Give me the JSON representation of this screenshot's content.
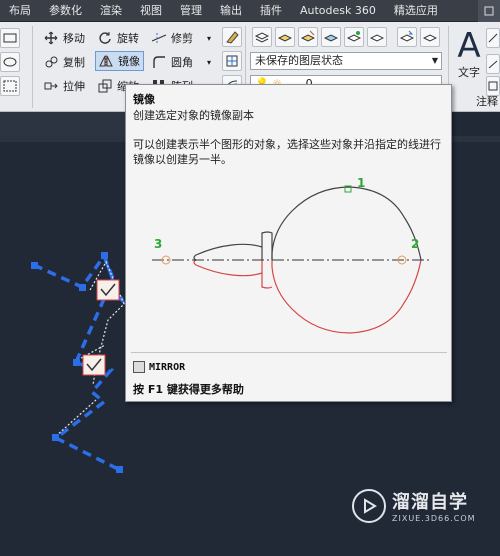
{
  "menubar": {
    "items": [
      "布局",
      "参数化",
      "渲染",
      "视图",
      "管理",
      "输出",
      "插件",
      "Autodesk 360",
      "精选应用"
    ]
  },
  "ribbon": {
    "modify": {
      "move": "移动",
      "rotate": "旋转",
      "trim": "修剪",
      "copy": "复制",
      "mirror": "镜像",
      "fillet": "圆角",
      "stretch": "拉伸",
      "scale": "缩放",
      "array": "阵列"
    },
    "layer_state": "未保存的图层状态",
    "layer_value": "0",
    "text_label": "文字",
    "annotate_label": "注释"
  },
  "tooltip": {
    "title": "镜像",
    "subtitle": "创建选定对象的镜像副本",
    "description": "可以创建表示半个图形的对象，选择这些对象并沿指定的线进行镜像以创建另一半。",
    "points": [
      "1",
      "2",
      "3"
    ],
    "command": "MIRROR",
    "help": "按 F1 键获得更多帮助"
  },
  "watermark": {
    "brand": "溜溜自学",
    "url": "ZIXUE.3D66.COM"
  },
  "colors": {
    "accent_blue": "#2f6fd1",
    "grip_blue": "#2b6ee8",
    "mirror_red": "#d64545",
    "point_green": "#2fa83a"
  }
}
